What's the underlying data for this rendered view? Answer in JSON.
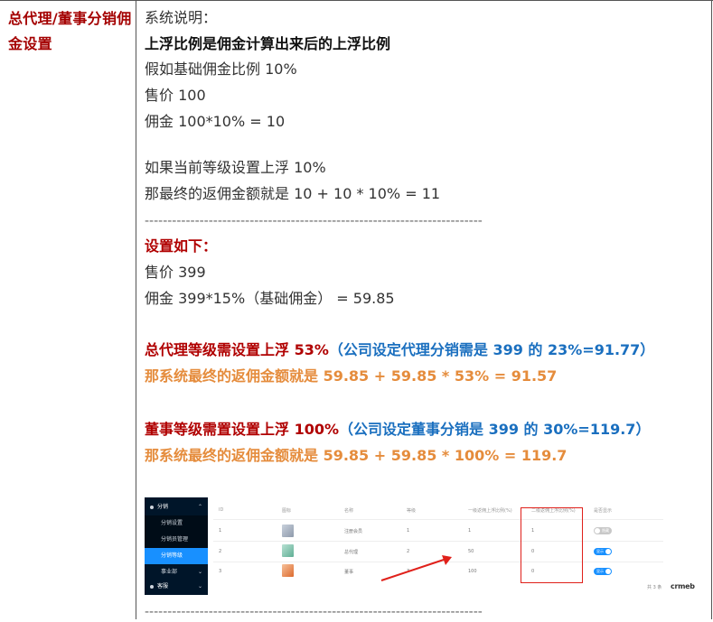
{
  "left_title": "总代理/董事分销佣金设置",
  "lines": {
    "l1": "系统说明：",
    "l2": "上浮比例是佣金计算出来后的上浮比例",
    "l3": "假如基础佣金比例  10%",
    "l4": "售价  100",
    "l5": "佣金  100*10% = 10",
    "l6": "如果当前等级设置上浮 10%",
    "l7": "那最终的返佣金额就是 10 + 10 * 10% = 11",
    "dash1": "--------------------------------------------------------------------------",
    "l8": "设置如下：",
    "l9": "售价  399",
    "l10": "佣金  399*15%（基础佣金）  = 59.85",
    "l11a": "总代理等级需设置上浮 53%",
    "l11b": "（公司设定代理分销需是 399 的 23%=91.77）",
    "l12": "那系统最终的返佣金额就是 59.85 + 59.85 * 53% = 91.57",
    "l13a": "董事等级需置设置上浮 100%",
    "l13b": "（公司设定董事分销是 399 的 30%=119.7）",
    "l14": "那系统最终的返佣金额就是 59.85 + 59.85 * 100% = 119.7",
    "dash2": "--------------------------------------------------------------------------"
  },
  "screenshot": {
    "sidebar": [
      {
        "label": "分销",
        "type": "top"
      },
      {
        "label": "分销设置",
        "type": "sub"
      },
      {
        "label": "分销员管理",
        "type": "sub"
      },
      {
        "label": "分销等级",
        "type": "active"
      },
      {
        "label": "事业部",
        "type": "top2"
      },
      {
        "label": "客服",
        "type": "top"
      }
    ],
    "headers": [
      "ID",
      "图标",
      "名称",
      "等级",
      "一级返佣上浮比例(%)",
      "二级返佣上浮比例(%)",
      "是否显示"
    ],
    "rows": [
      {
        "id": "1",
        "name": "注册会员",
        "level": "1",
        "rate1": "1",
        "rate2": "1",
        "show": "off",
        "thumb_color": "#aab4c2"
      },
      {
        "id": "2",
        "name": "总代理",
        "level": "2",
        "rate1": "50",
        "rate2": "0",
        "show": "on",
        "thumb_color": "#7fc6b0"
      },
      {
        "id": "3",
        "name": "董事",
        "level": "3",
        "rate1": "100",
        "rate2": "0",
        "show": "on",
        "thumb_color": "#e8864a"
      }
    ],
    "toggle_on": "显示",
    "toggle_off": "隐藏",
    "footer": "共 3 条",
    "logo": "crmeb"
  }
}
